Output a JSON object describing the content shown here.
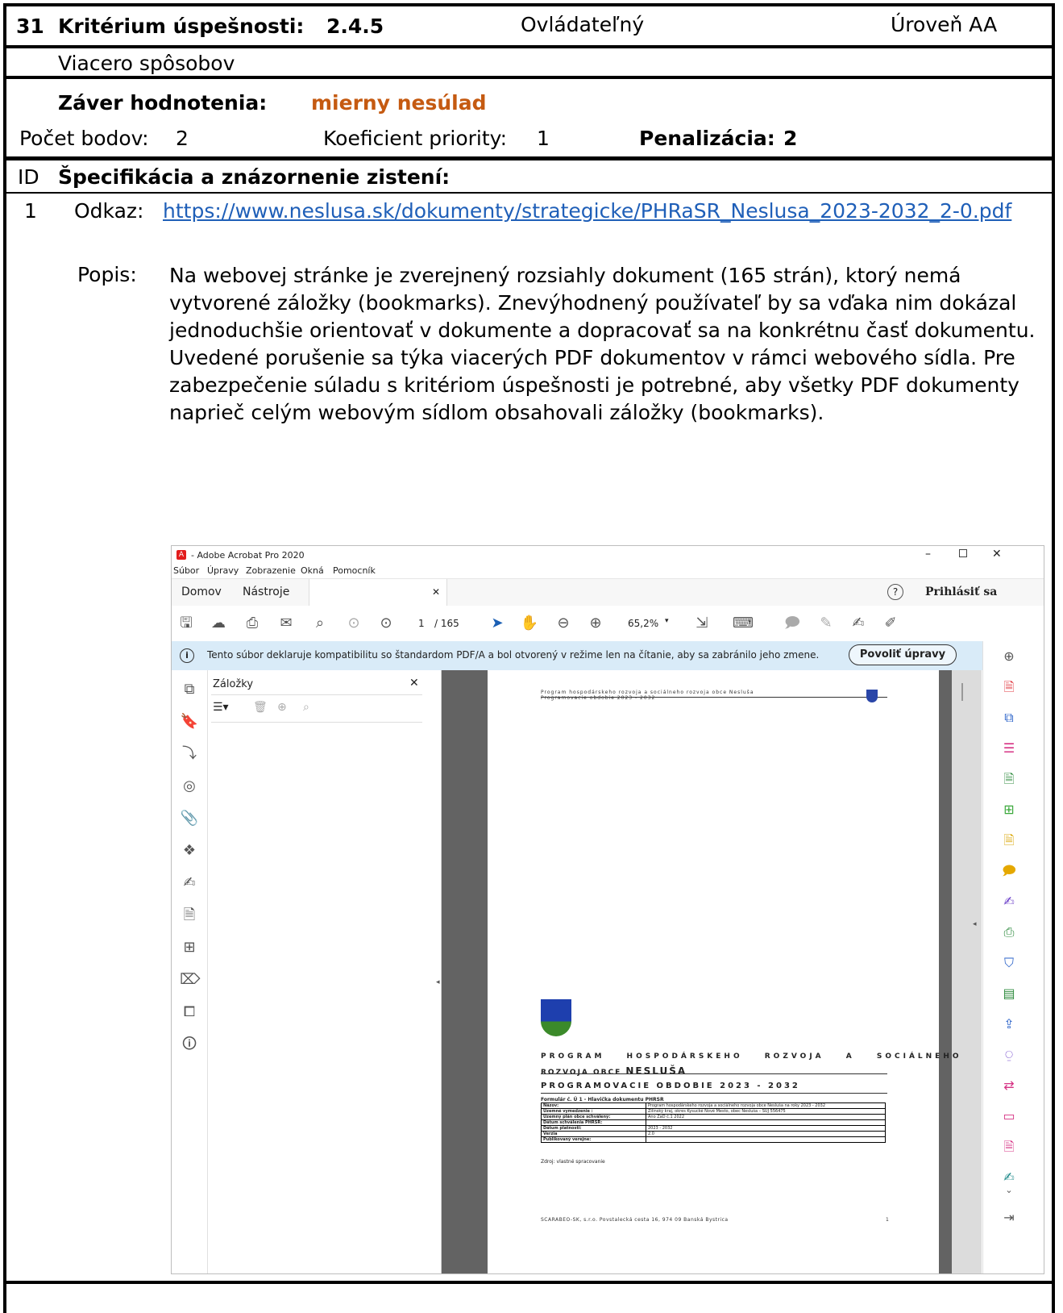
{
  "header": {
    "number": "31",
    "criterion_label": "Kritérium úspešnosti:",
    "criterion_code": "2.4.5",
    "principle": "Ovládateľný",
    "level": "Úroveň AA",
    "criterion_name": "Viacero spôsobov",
    "conclusion_label": "Záver hodnotenia:",
    "conclusion_value": "mierny nesúlad",
    "points_label": "Počet bodov:",
    "points_value": "2",
    "priority_label": "Koeficient priority:",
    "priority_value": "1",
    "penalty_label": "Penalizácia:",
    "penalty_value": "2"
  },
  "findings_header": {
    "id_label": "ID",
    "title": "Špecifikácia a znázornenie zistení:"
  },
  "finding": {
    "id": "1",
    "link_label": "Odkaz:",
    "link_url": "https://www.neslusa.sk/dokumenty/strategicke/PHRaSR_Neslusa_2023-2032_2-0.pdf",
    "desc_label": "Popis:",
    "desc_paragraph_1": "Na webovej stránke je zverejnený rozsiahly dokument (165 strán), ktorý nemá vytvorené záložky (bookmarks). Znevýhodnený používateľ by sa vďaka nim dokázal jednoduchšie orientovať v dokumente a dopracovať sa na konkrétnu časť dokumentu.",
    "desc_paragraph_2": "Uvedené porušenie sa týka viacerých PDF dokumentov v rámci webového sídla. Pre zabezpečenie súladu s kritériom úspešnosti je potrebné, aby všetky PDF dokumenty naprieč celým webovým sídlom obsahovali záložky (bookmarks)."
  },
  "acrobat": {
    "window_title": "- Adobe Acrobat Pro 2020",
    "menu": [
      "Súbor",
      "Úpravy",
      "Zobrazenie",
      "Okná",
      "Pomocník"
    ],
    "tab_home": "Domov",
    "tab_tools": "Nástroje",
    "sign_in": "Prihlásiť sa",
    "page_current": "1",
    "page_total": "/ 165",
    "zoom": "65,2%",
    "banner_text": "Tento súbor deklaruje kompatibilitu so štandardom PDF/A a bol otvorený v režime len na čítanie, aby sa zabránilo jeho zmene.",
    "banner_button": "Povoliť úpravy",
    "panel_title": "Záložky",
    "doc_header_1": "Program hospodárskeho rozvoja a sociálneho rozvoja obce Nesluša",
    "doc_header_2": "Programovacie obdobie 2023 - 2032",
    "doc_title_1": "PROGRAM HOSPODÁRSKEHO ROZVOJA A SOCIÁLNEHO",
    "doc_title_2a": "ROZVOJA OBCE",
    "doc_title_2b": "NESLUŠA",
    "doc_title_3": "PROGRAMOVACIE OBDOBIE 2023 - 2032",
    "form_caption": "Formulár č. Ú 1 - Hlavička dokumentu PHRSR",
    "form_rows": [
      {
        "k": "Názov:",
        "v": "Program hospodárskeho rozvoja a sociálneho rozvoja obce Nesluša na roky 2023 - 2032"
      },
      {
        "k": "Územné vymedzenie :",
        "v": "Žilinský kraj, okres Kysucké Nové Mesto, obec Nesluša – ŠÚJ 556475"
      },
      {
        "k": "Územný plán obce schválený:",
        "v": "Áno ZaD č.1 2022"
      },
      {
        "k": "Dátum schválenia PHRSR:",
        "v": ""
      },
      {
        "k": "Dátum platnosti:",
        "v": "2023 - 2032"
      },
      {
        "k": "Verzia",
        "v": "2.0"
      },
      {
        "k": "Publikovaný verejne:",
        "v": ""
      }
    ],
    "form_source": "Zdroj: vlastné spracovanie",
    "doc_footer": "SCARABEO-SK, s.r.o. Povstalecká cesta 16, 974 09 Banská Bystrica",
    "doc_page_no": "1"
  }
}
